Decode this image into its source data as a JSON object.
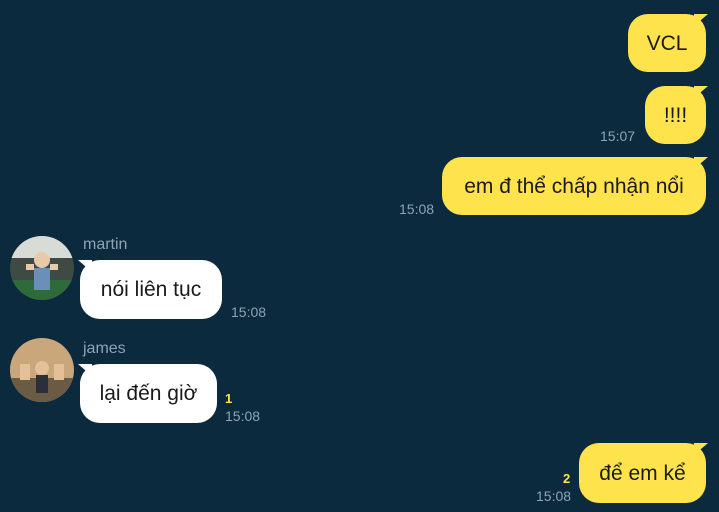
{
  "chat": {
    "messages": [
      {
        "id": "m1",
        "text": "VCL",
        "time": ""
      },
      {
        "id": "m2",
        "text": "!!!!",
        "time": "15:07"
      },
      {
        "id": "m3",
        "text": "em đ thể chấp nhận nổi",
        "time": "15:08"
      },
      {
        "id": "m4",
        "sender": "martin",
        "text": "nói liên tục",
        "time": "15:08"
      },
      {
        "id": "m5",
        "sender": "james",
        "text": "lại đến giờ",
        "time": "15:08",
        "unread": "1"
      },
      {
        "id": "m6",
        "text": "để em kể",
        "time": "15:08",
        "unread": "2"
      }
    ]
  },
  "colors": {
    "background": "#0b2a3d",
    "my_bubble": "#ffe34d",
    "their_bubble": "#ffffff",
    "meta_text": "#8fa3b3"
  }
}
